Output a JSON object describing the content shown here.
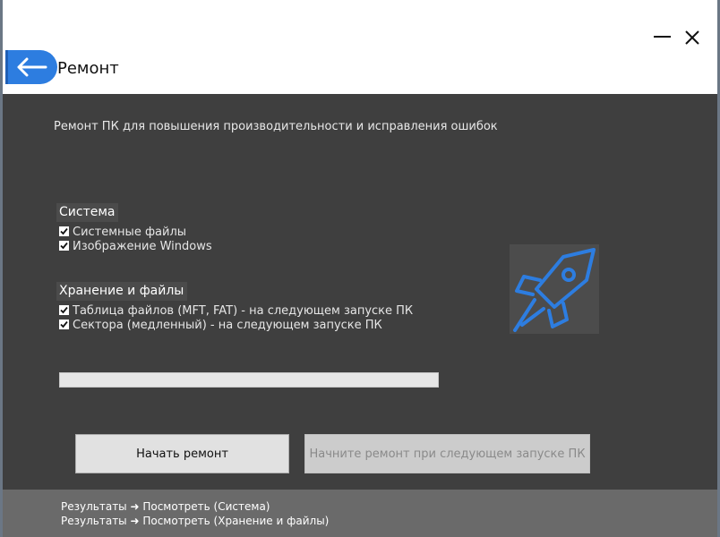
{
  "window": {
    "title": "Ремонт",
    "subtitle": "Ремонт ПК для повышения производительности и исправления ошибок"
  },
  "sections": [
    {
      "title": "Система",
      "items": [
        {
          "label": "Системные файлы",
          "checked": true
        },
        {
          "label": "Изображение Windows",
          "checked": true
        }
      ]
    },
    {
      "title": "Хранение и файлы",
      "items": [
        {
          "label": "Таблица файлов (MFT, FAT)  -  на следующем запуске ПК",
          "checked": true
        },
        {
          "label": "Сектора (медленный)  -  на следующем запуске ПК",
          "checked": true
        }
      ]
    }
  ],
  "progress": {
    "percent": 0
  },
  "buttons": {
    "start_repair": "Начать ремонт",
    "start_next_boot": "Начните ремонт при следующем запуске ПК"
  },
  "footer": {
    "links": [
      "Результаты ➜ Посмотреть (Система)",
      "Результаты ➜ Посмотреть (Хранение и файлы)"
    ]
  },
  "icons": {
    "back": "arrow-left-icon",
    "minimize": "minimize-icon",
    "close": "close-icon",
    "hero": "rocket-icon"
  },
  "colors": {
    "accent": "#2d7de0",
    "background": "#3f3f3f",
    "footer": "#6a6a6a"
  }
}
